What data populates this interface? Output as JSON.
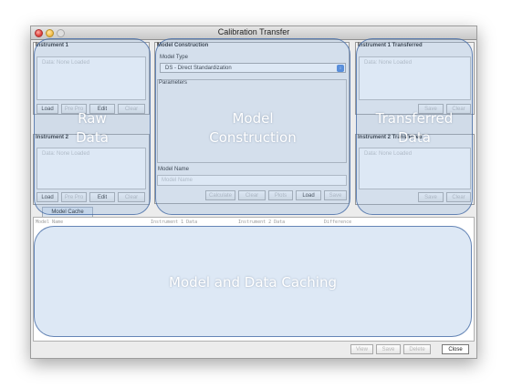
{
  "window": {
    "title": "Calibration Transfer"
  },
  "instrument1": {
    "title": "Instrument 1",
    "data_text": "Data: None Loaded",
    "buttons": [
      "Load",
      "Pre Pro",
      "Edit",
      "Clear"
    ]
  },
  "instrument2": {
    "title": "Instrument 2",
    "data_text": "Data: None Loaded",
    "buttons": [
      "Load",
      "Pre Pro",
      "Edit",
      "Clear"
    ]
  },
  "model_construction": {
    "title": "Model Construction",
    "model_type_label": "Model Type",
    "model_type_value": "DS - Direct Standardization",
    "parameters_label": "Parameters",
    "model_name_label": "Model Name",
    "model_name_placeholder": "Model Name",
    "buttons": [
      "Calculate",
      "Clear",
      "Plots",
      "Load",
      "Save"
    ]
  },
  "transferred1": {
    "title": "Instrument 1 Transferred",
    "data_text": "Data: None Loaded",
    "buttons": [
      "Save",
      "Clear"
    ]
  },
  "transferred2": {
    "title": "Instrument 2 Transferred",
    "data_text": "Data: None Loaded",
    "buttons": [
      "Save",
      "Clear"
    ]
  },
  "cache": {
    "tab": "Model Cache",
    "columns": [
      "Model Name",
      "Instrument 1 Data",
      "Instrument 2 Data",
      "Difference"
    ],
    "buttons": [
      "View",
      "Save",
      "Delete",
      "Close"
    ]
  },
  "overlays": {
    "raw_data": "Raw\nData",
    "model_construction": "Model\nConstruction",
    "transferred_data": "Transferred\nData",
    "caching": "Model and Data Caching"
  },
  "colors": {
    "overlay_fill": "#96b9e1",
    "overlay_border": "#3c64a0",
    "select_arrow": "#3b7bd9"
  }
}
